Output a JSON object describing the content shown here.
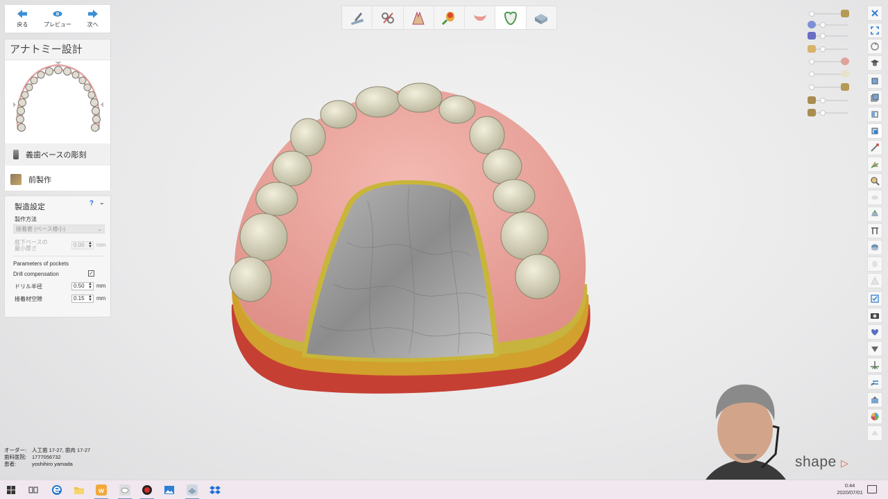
{
  "nav": {
    "back_label": "戻る",
    "preview_label": "プレビュー",
    "next_label": "次へ"
  },
  "design": {
    "title": "アナトミー設計",
    "steps": [
      "義歯ベースの彫刻",
      "前製作"
    ]
  },
  "settings": {
    "title": "製造設定",
    "help": "?",
    "method_label": "製作方法",
    "method_value": "接着套 (ベース様小)",
    "min_thickness_label_1": "底下ベースの",
    "min_thickness_label_2": "最小厚さ",
    "min_thickness_value": "0.00",
    "pockets_label": "Parameters of pockets",
    "drill_comp_label": "Drill compensation",
    "drill_comp_checked": "✓",
    "drill_radius_label": "ドリル半径",
    "drill_radius_value": "0.50",
    "cement_gap_label": "接着材空隙",
    "cement_gap_value": "0.15",
    "unit": "mm"
  },
  "toolbar": {
    "tools": [
      "scan-tool-icon",
      "trim-tool-icon",
      "teeth-setup-icon",
      "brush-tool-icon",
      "gingiva-icon",
      "anatomy-tooth-icon",
      "base-icon"
    ],
    "active_index": 5
  },
  "info": {
    "order_key": "オーダー:",
    "order_value": "人工歯 17-27, 歯肉 17-27",
    "lab_key": "歯科医院:",
    "lab_value": "1777056732",
    "patient_key": "患者:",
    "patient_value": "yoshihiro yamada"
  },
  "brand": {
    "name": "shape"
  },
  "taskbar": {
    "time": "0:44",
    "date": "2020/07/01"
  },
  "colors": {
    "accent": "#3b8ed3",
    "gingiva": "#e8a49b",
    "tooth": "#ddd9c2",
    "palate_metal": "#8d8d8d",
    "wax": "#c9b53a"
  }
}
